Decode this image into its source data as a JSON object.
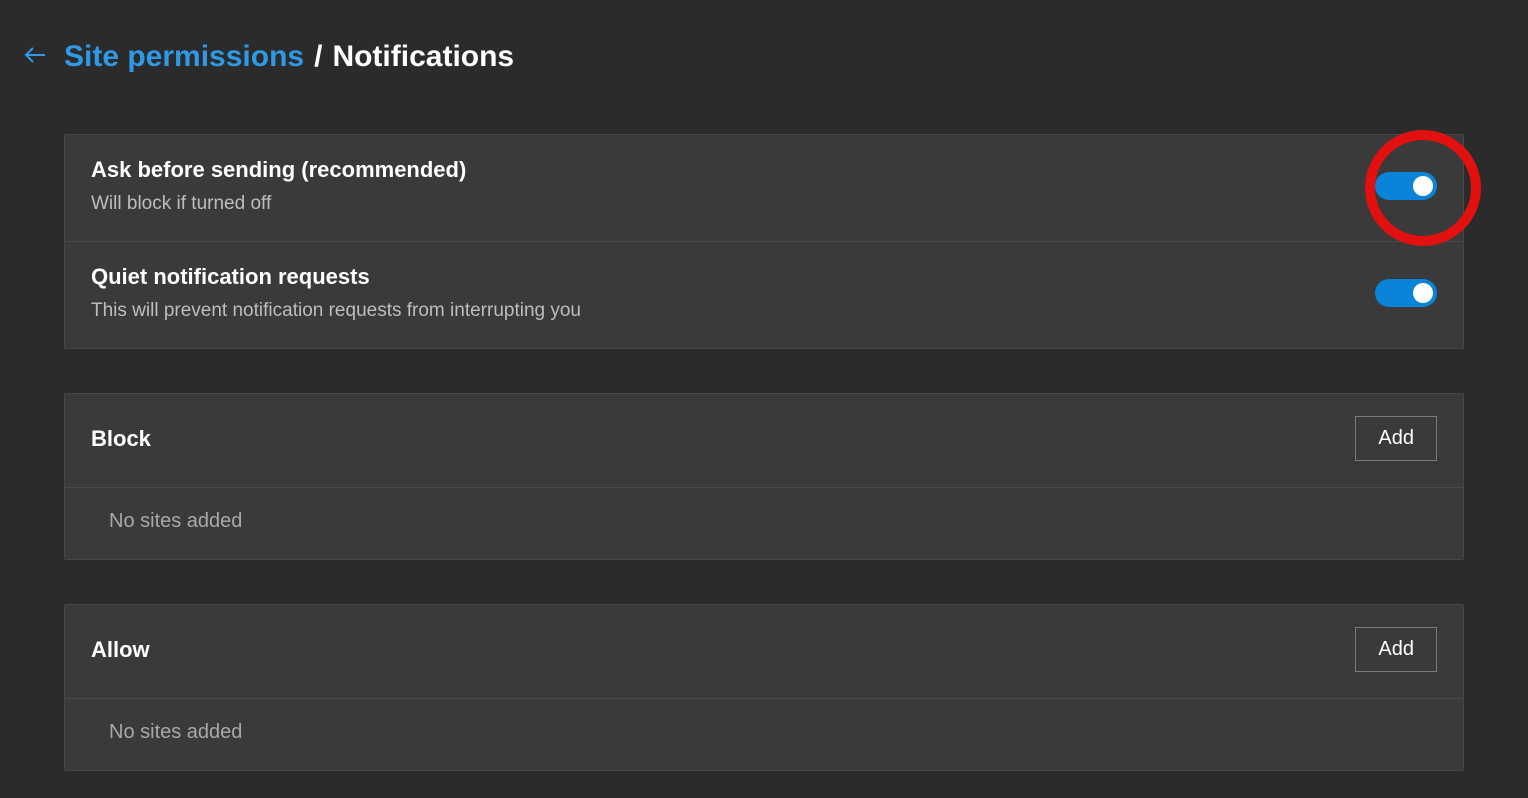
{
  "breadcrumb": {
    "parent": "Site permissions",
    "separator": "/",
    "current": "Notifications"
  },
  "settings": [
    {
      "title": "Ask before sending (recommended)",
      "desc": "Will block if turned off",
      "toggled": true,
      "highlighted": true
    },
    {
      "title": "Quiet notification requests",
      "desc": "This will prevent notification requests from interrupting you",
      "toggled": true,
      "highlighted": false
    }
  ],
  "lists": {
    "block": {
      "title": "Block",
      "add_label": "Add",
      "empty_text": "No sites added"
    },
    "allow": {
      "title": "Allow",
      "add_label": "Add",
      "empty_text": "No sites added"
    }
  }
}
